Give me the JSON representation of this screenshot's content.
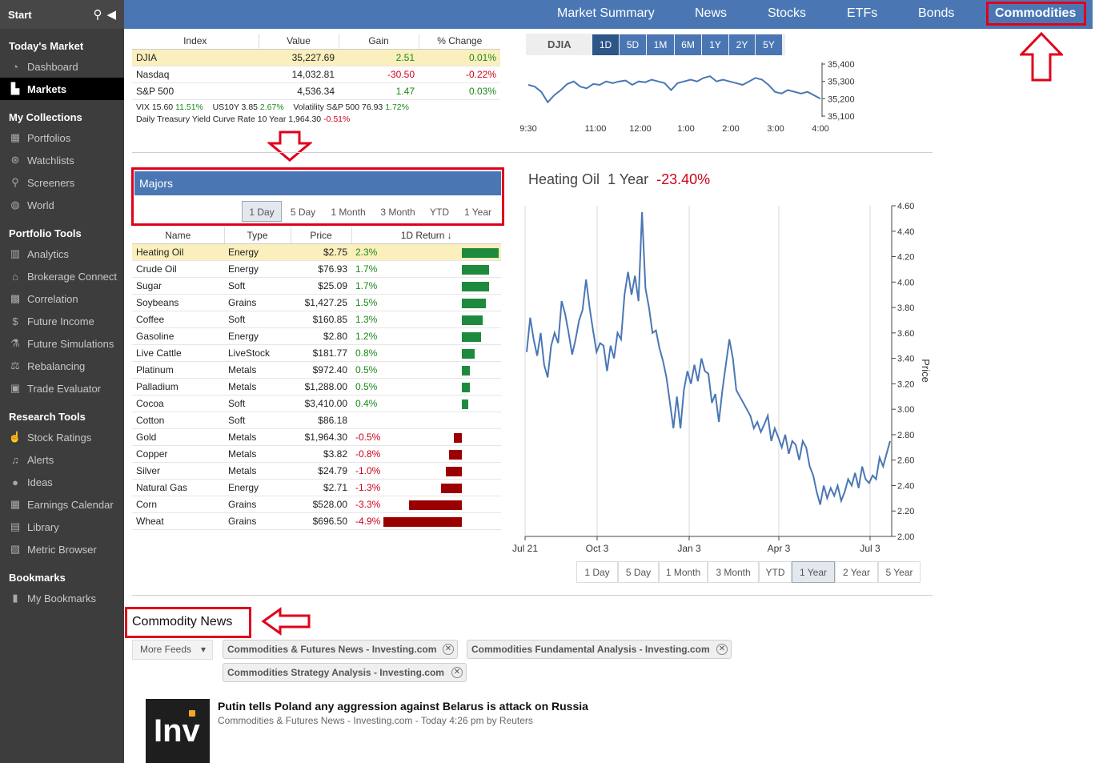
{
  "sidebar": {
    "start": "Start",
    "sections": [
      {
        "title": "Today's Market",
        "items": [
          {
            "label": "Dashboard",
            "icon": "dashboard-icon",
            "glyph": "◔"
          },
          {
            "label": "Markets",
            "icon": "markets-chart-icon",
            "glyph": "▙",
            "active": true
          }
        ]
      },
      {
        "title": "My Collections",
        "items": [
          {
            "label": "Portfolios",
            "icon": "portfolio-icon",
            "glyph": "▦"
          },
          {
            "label": "Watchlists",
            "icon": "binoculars-icon",
            "glyph": "⊛"
          },
          {
            "label": "Screeners",
            "icon": "search-icon",
            "glyph": "⚲"
          },
          {
            "label": "World",
            "icon": "globe-icon",
            "glyph": "◍"
          }
        ]
      },
      {
        "title": "Portfolio Tools",
        "items": [
          {
            "label": "Analytics",
            "icon": "analytics-icon",
            "glyph": "▥"
          },
          {
            "label": "Brokerage Connect",
            "icon": "bank-icon",
            "glyph": "⌂"
          },
          {
            "label": "Correlation",
            "icon": "grid-icon",
            "glyph": "▩"
          },
          {
            "label": "Future Income",
            "icon": "dollar-icon",
            "glyph": "$"
          },
          {
            "label": "Future Simulations",
            "icon": "flask-icon",
            "glyph": "⚗"
          },
          {
            "label": "Rebalancing",
            "icon": "balance-scale-icon",
            "glyph": "⚖"
          },
          {
            "label": "Trade Evaluator",
            "icon": "briefcase-icon",
            "glyph": "▣"
          }
        ]
      },
      {
        "title": "Research Tools",
        "items": [
          {
            "label": "Stock Ratings",
            "icon": "thumbs-up-icon",
            "glyph": "☝"
          },
          {
            "label": "Alerts",
            "icon": "bell-icon",
            "glyph": "♫"
          },
          {
            "label": "Ideas",
            "icon": "lightbulb-icon",
            "glyph": "●"
          },
          {
            "label": "Earnings Calendar",
            "icon": "calendar-icon",
            "glyph": "▦"
          },
          {
            "label": "Library",
            "icon": "library-icon",
            "glyph": "▤"
          },
          {
            "label": "Metric Browser",
            "icon": "metric-browser-icon",
            "glyph": "▧"
          }
        ]
      },
      {
        "title": "Bookmarks",
        "items": [
          {
            "label": "My Bookmarks",
            "icon": "bookmark-icon",
            "glyph": "▮"
          }
        ]
      }
    ]
  },
  "topnav": {
    "items": [
      "Market Summary",
      "News",
      "Stocks",
      "ETFs",
      "Bonds",
      "Commodities"
    ],
    "active": "Commodities"
  },
  "index_table": {
    "headers": [
      "Index",
      "Value",
      "Gain",
      "% Change"
    ],
    "rows": [
      {
        "name": "DJIA",
        "value": "35,227.69",
        "gain": "2.51",
        "pct": "0.01%"
      },
      {
        "name": "Nasdaq",
        "value": "14,032.81",
        "gain": "-30.50",
        "pct": "-0.22%"
      },
      {
        "name": "S&P 500",
        "value": "4,536.34",
        "gain": "1.47",
        "pct": "0.03%"
      }
    ],
    "note1": {
      "vix_label": "VIX 15.60",
      "vix_chg": "11.51%",
      "us10_label": "US10Y 3.85",
      "us10_chg": "2.67%",
      "vol_label": "Volatility S&P 500 76.93",
      "vol_chg": "1.72%"
    },
    "note2": {
      "label": "Daily Treasury Yield Curve Rate 10 Year 1,964.30",
      "chg": "-0.51%"
    }
  },
  "djia_chart": {
    "label": "DJIA",
    "ranges": [
      "1D",
      "5D",
      "1M",
      "6M",
      "1Y",
      "2Y",
      "5Y"
    ],
    "selected": "1D",
    "y_ticks": [
      "35,400",
      "35,300",
      "35,200",
      "35,100"
    ],
    "x_ticks": [
      "9:30",
      "11:00",
      "12:00",
      "1:00",
      "2:00",
      "3:00",
      "4:00"
    ]
  },
  "majors": {
    "title": "Majors",
    "ranges": [
      "1 Day",
      "5 Day",
      "1 Month",
      "3 Month",
      "YTD",
      "1 Year"
    ],
    "selected": "1 Day",
    "headers": [
      "Name",
      "Type",
      "Price",
      "1D Return ↓"
    ],
    "rows": [
      {
        "name": "Heating Oil",
        "type": "Energy",
        "price": "$2.75",
        "ret": "2.3%",
        "val": 2.3
      },
      {
        "name": "Crude Oil",
        "type": "Energy",
        "price": "$76.93",
        "ret": "1.7%",
        "val": 1.7
      },
      {
        "name": "Sugar",
        "type": "Soft",
        "price": "$25.09",
        "ret": "1.7%",
        "val": 1.7
      },
      {
        "name": "Soybeans",
        "type": "Grains",
        "price": "$1,427.25",
        "ret": "1.5%",
        "val": 1.5
      },
      {
        "name": "Coffee",
        "type": "Soft",
        "price": "$160.85",
        "ret": "1.3%",
        "val": 1.3
      },
      {
        "name": "Gasoline",
        "type": "Energy",
        "price": "$2.80",
        "ret": "1.2%",
        "val": 1.2
      },
      {
        "name": "Live Cattle",
        "type": "LiveStock",
        "price": "$181.77",
        "ret": "0.8%",
        "val": 0.8
      },
      {
        "name": "Platinum",
        "type": "Metals",
        "price": "$972.40",
        "ret": "0.5%",
        "val": 0.5
      },
      {
        "name": "Palladium",
        "type": "Metals",
        "price": "$1,288.00",
        "ret": "0.5%",
        "val": 0.5
      },
      {
        "name": "Cocoa",
        "type": "Soft",
        "price": "$3,410.00",
        "ret": "0.4%",
        "val": 0.4
      },
      {
        "name": "Cotton",
        "type": "Soft",
        "price": "$86.18",
        "ret": "",
        "val": 0
      },
      {
        "name": "Gold",
        "type": "Metals",
        "price": "$1,964.30",
        "ret": "-0.5%",
        "val": -0.5
      },
      {
        "name": "Copper",
        "type": "Metals",
        "price": "$3.82",
        "ret": "-0.8%",
        "val": -0.8
      },
      {
        "name": "Silver",
        "type": "Metals",
        "price": "$24.79",
        "ret": "-1.0%",
        "val": -1.0
      },
      {
        "name": "Natural Gas",
        "type": "Energy",
        "price": "$2.71",
        "ret": "-1.3%",
        "val": -1.3
      },
      {
        "name": "Corn",
        "type": "Grains",
        "price": "$528.00",
        "ret": "-3.3%",
        "val": -3.3
      },
      {
        "name": "Wheat",
        "type": "Grains",
        "price": "$696.50",
        "ret": "-4.9%",
        "val": -4.9
      }
    ]
  },
  "main_chart": {
    "name": "Heating Oil",
    "period": "1 Year",
    "change": "-23.40%",
    "ranges": [
      "1 Day",
      "5 Day",
      "1 Month",
      "3 Month",
      "YTD",
      "1 Year",
      "2 Year",
      "5 Year"
    ],
    "selected": "1 Year"
  },
  "chart_data": [
    {
      "type": "line",
      "title": "DJIA",
      "x_ticks": [
        "9:30",
        "11:00",
        "12:00",
        "1:00",
        "2:00",
        "3:00",
        "4:00"
      ],
      "ylim": [
        35100,
        35400
      ],
      "y_ticks": [
        35100,
        35200,
        35300,
        35400
      ],
      "color": "#4a77b4",
      "values": [
        35280,
        35270,
        35240,
        35180,
        35220,
        35250,
        35285,
        35300,
        35270,
        35260,
        35285,
        35280,
        35300,
        35290,
        35300,
        35305,
        35280,
        35300,
        35295,
        35310,
        35300,
        35290,
        35250,
        35290,
        35300,
        35310,
        35300,
        35320,
        35330,
        35300,
        35310,
        35300,
        35290,
        35280,
        35300,
        35320,
        35310,
        35280,
        35240,
        35230,
        35250,
        35240,
        35230,
        35240,
        35220,
        35200
      ]
    },
    {
      "type": "line",
      "title": "Heating Oil 1 Year -23.40%",
      "x_ticks": [
        "Jul 21",
        "Oct 3",
        "Jan 3",
        "Apr 3",
        "Jul 3"
      ],
      "ylim": [
        2.0,
        4.6
      ],
      "y_ticks": [
        2.0,
        2.2,
        2.4,
        2.6,
        2.8,
        3.0,
        3.2,
        3.4,
        3.6,
        3.8,
        4.0,
        4.2,
        4.4,
        4.6
      ],
      "ylabel": "Price",
      "color": "#4a77b4",
      "values": [
        3.45,
        3.72,
        3.55,
        3.42,
        3.6,
        3.35,
        3.25,
        3.5,
        3.6,
        3.52,
        3.85,
        3.75,
        3.6,
        3.43,
        3.55,
        3.7,
        3.78,
        4.02,
        3.8,
        3.62,
        3.45,
        3.52,
        3.5,
        3.3,
        3.5,
        3.4,
        3.6,
        3.55,
        3.9,
        4.08,
        3.9,
        4.05,
        3.85,
        4.55,
        3.95,
        3.8,
        3.6,
        3.62,
        3.48,
        3.38,
        3.25,
        3.05,
        2.85,
        3.1,
        2.85,
        3.15,
        3.3,
        3.2,
        3.35,
        3.22,
        3.4,
        3.3,
        3.28,
        3.05,
        3.12,
        2.9,
        3.15,
        3.35,
        3.55,
        3.4,
        3.15,
        3.1,
        3.05,
        3.0,
        2.95,
        2.85,
        2.9,
        2.82,
        2.88,
        2.95,
        2.75,
        2.85,
        2.78,
        2.7,
        2.8,
        2.65,
        2.75,
        2.72,
        2.6,
        2.75,
        2.7,
        2.55,
        2.48,
        2.35,
        2.25,
        2.4,
        2.3,
        2.38,
        2.32,
        2.4,
        2.28,
        2.35,
        2.45,
        2.4,
        2.5,
        2.38,
        2.55,
        2.45,
        2.42,
        2.48,
        2.45,
        2.62,
        2.55,
        2.65,
        2.75
      ]
    }
  ],
  "news": {
    "title": "Commodity News",
    "more_feeds": "More Feeds",
    "chips": [
      "Commodities & Futures News - Investing.com",
      "Commodities Fundamental Analysis - Investing.com",
      "Commodities Strategy Analysis - Investing.com"
    ],
    "article": {
      "logo": "Inv",
      "headline": "Putin tells Poland any aggression against Belarus is attack on Russia",
      "meta": "Commodities & Futures News - Investing.com - Today 4:26 pm by Reuters"
    }
  },
  "colors": {
    "accent": "#4a77b4",
    "highlight": "#fbefbd",
    "positive": "#1e8a3e",
    "negative": "#9b0000",
    "annotation": "#e0001a"
  }
}
